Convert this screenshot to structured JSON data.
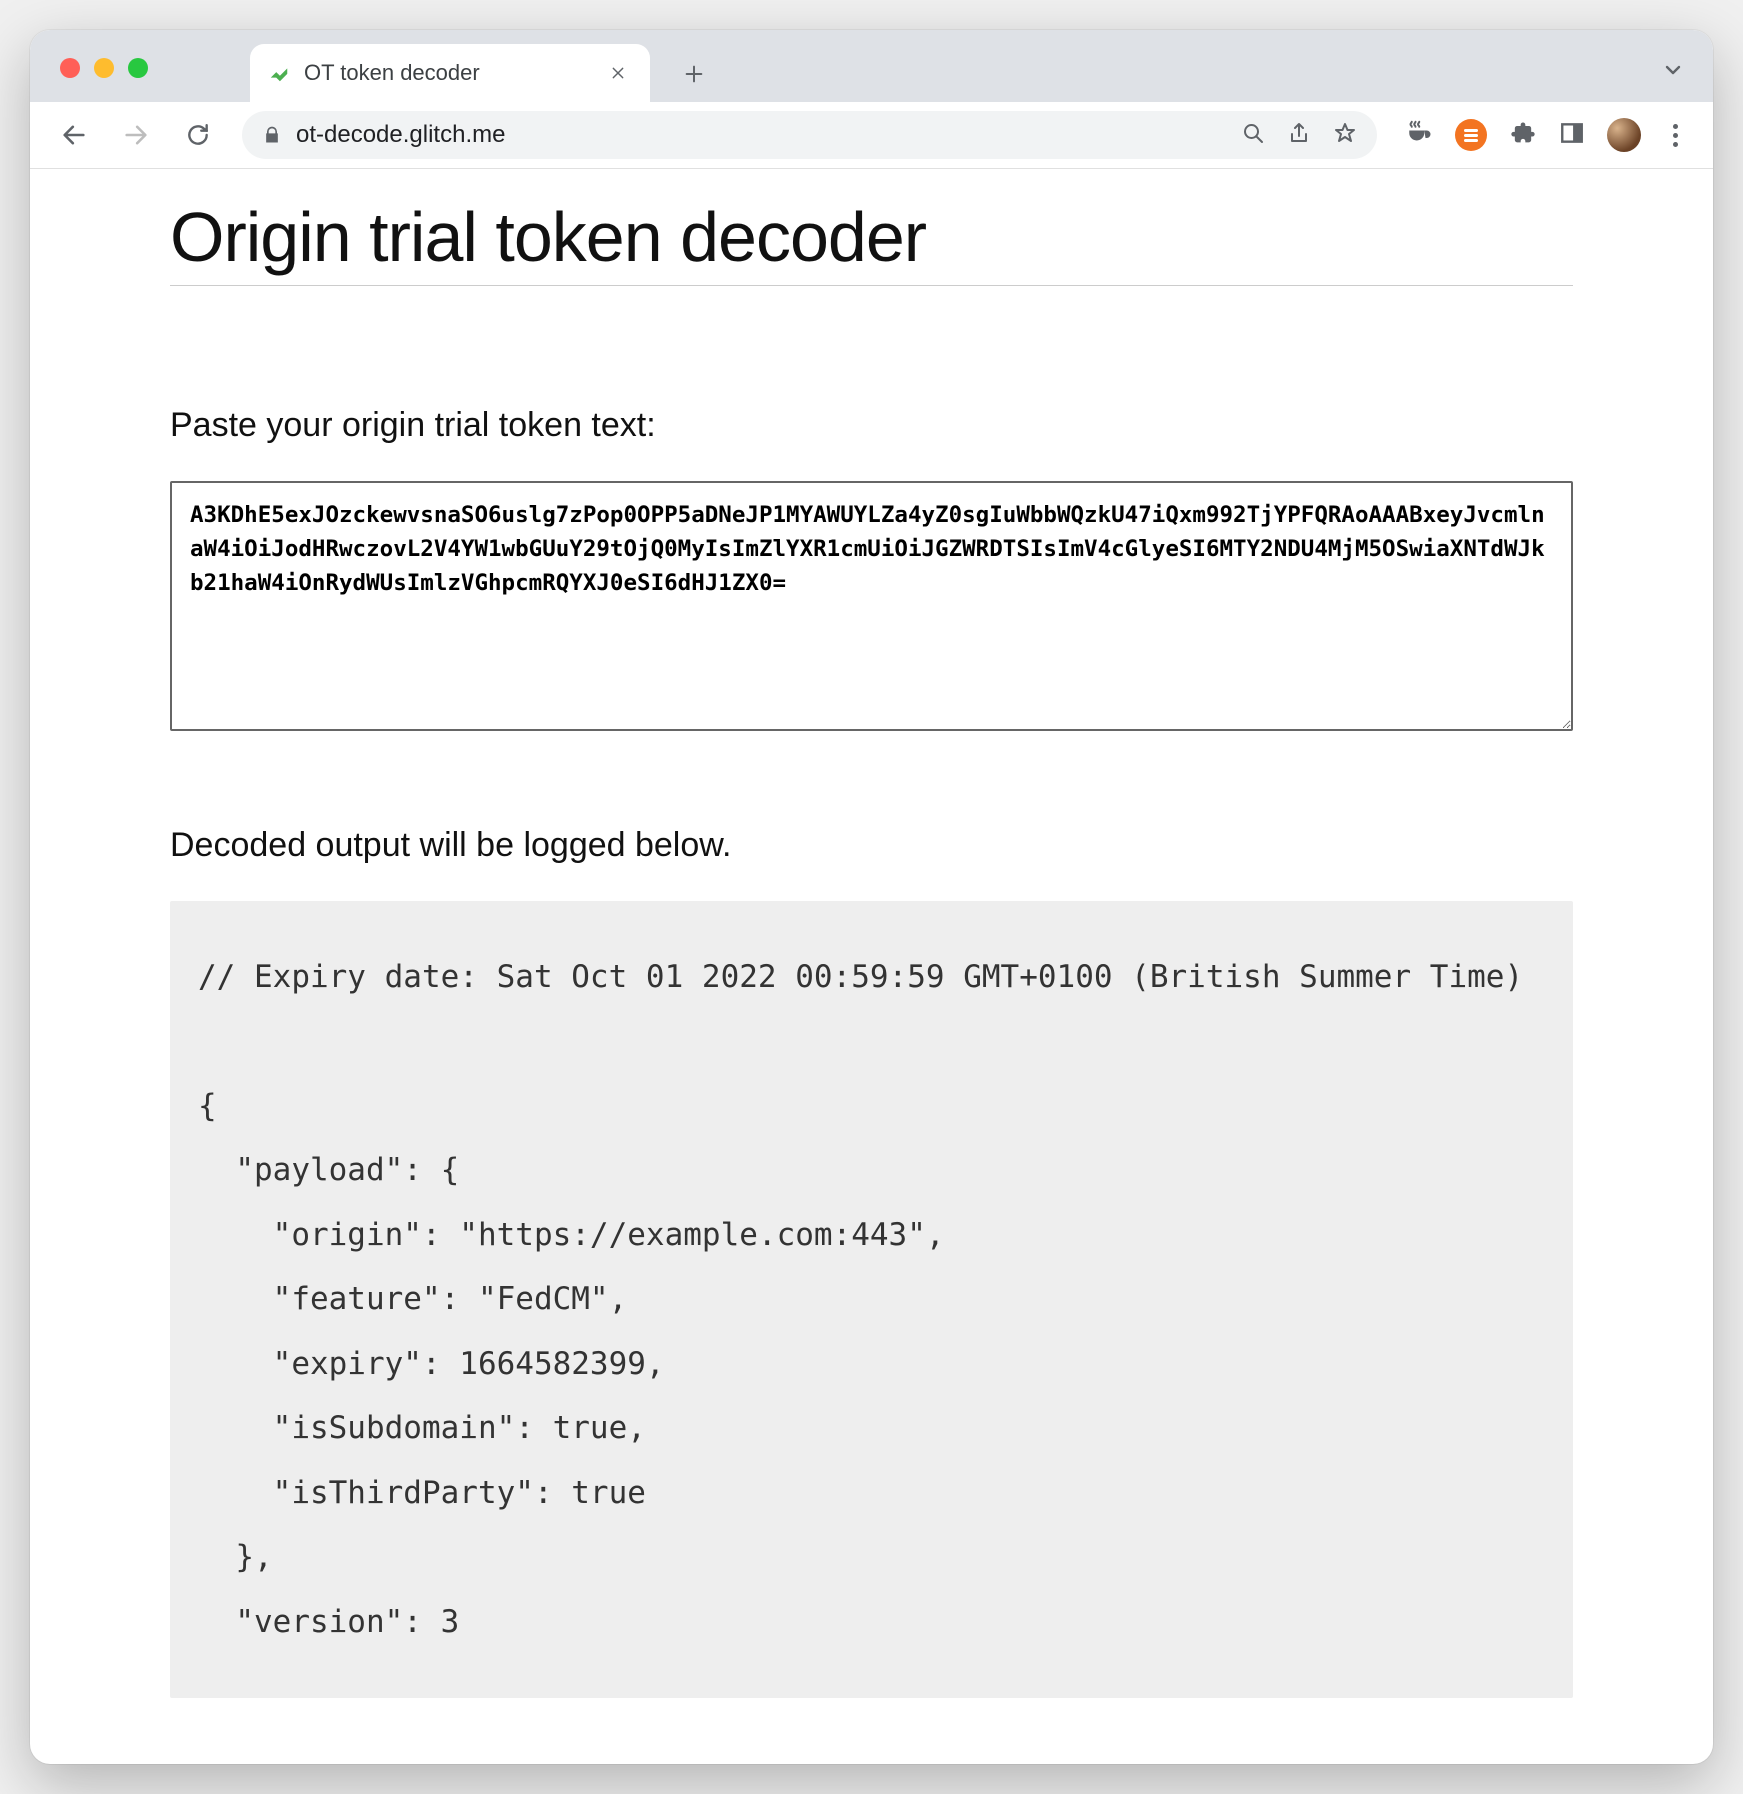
{
  "browser": {
    "tab_title": "OT token decoder",
    "url": "ot-decode.glitch.me"
  },
  "page": {
    "heading": "Origin trial token decoder",
    "input_label": "Paste your origin trial token text:",
    "token_value": "A3KDhE5exJOzckewvsnaSO6uslg7zPop0OPP5aDNeJP1MYAWUYLZa4yZ0sgIuWbbWQzkU47iQxm992TjYPFQRAoAAABxeyJvcmlnaW4iOiJodHRwczovL2V4YW1wbGUuY29tOjQ0MyIsImZlYXR1cmUiOiJGZWRDTSIsImV4cGlyeSI6MTY2NDU4MjM5OSwiaXNTdWJkb21haW4iOnRydWUsImlzVGhpcmRQYXJ0eSI6dHJ1ZX0=",
    "output_label": "Decoded output will be logged below.",
    "decoded_output": "// Expiry date: Sat Oct 01 2022 00:59:59 GMT+0100 (British Summer Time)\n\n{\n  \"payload\": {\n    \"origin\": \"https://example.com:443\",\n    \"feature\": \"FedCM\",\n    \"expiry\": 1664582399,\n    \"isSubdomain\": true,\n    \"isThirdParty\": true\n  },\n  \"version\": 3"
  }
}
